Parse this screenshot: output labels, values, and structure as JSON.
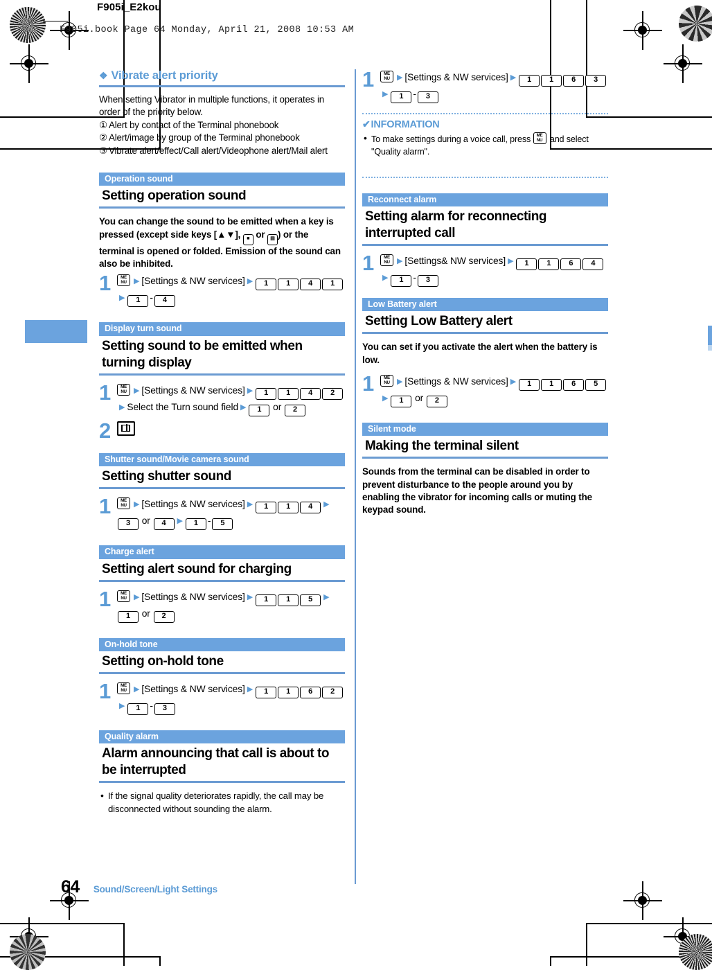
{
  "page": {
    "doc_title": "F905i_E2kou",
    "book_line": "F905i.book  Page 64  Monday, April 21, 2008  10:53 AM",
    "footer_page": "64",
    "footer_chapter": "Sound/Screen/Light Settings",
    "accent_blue": "#6ba3de",
    "heading_blue": "#5b9bd5"
  },
  "left_column": {
    "vibrate": {
      "diamond": "❖",
      "heading": "Vibrate alert priority",
      "intro": "When setting Vibrator in multiple functions, it operates in order of the priority below.",
      "items": [
        {
          "num": "①",
          "text": "Alert by contact of the Terminal phonebook"
        },
        {
          "num": "②",
          "text": "Alert/image by group of the Terminal phonebook"
        },
        {
          "num": "③",
          "text": "Vibrate alert/effect/Call alert/Videophone alert/Mail alert"
        }
      ]
    },
    "operation_sound": {
      "tag": "Operation sound",
      "title": "Setting operation sound",
      "body": "You can change the sound to be emitted when a key is pressed (except side keys [▲▼], ",
      "body_mid": " or ",
      "body_end": ") or the terminal is opened or folded. Emission of the sound can also be inhibited.",
      "step1_num": "1",
      "step1_menu": "MENU",
      "step1_label": "[Settings & NW services]",
      "step1_keys": [
        "1",
        "1",
        "4",
        "1"
      ],
      "step1_range_from": "1",
      "step1_range_to": "4"
    },
    "display_turn_sound": {
      "tag": "Display turn sound",
      "title": "Setting sound to be emitted when turning display",
      "step1_num": "1",
      "step1_label": "[Settings & NW services]",
      "step1_keys": [
        "1",
        "1",
        "4",
        "2"
      ],
      "step1_select": "Select the Turn sound field",
      "step1_opt_a": "1",
      "step1_or": "or",
      "step1_opt_b": "2",
      "step2_num": "2"
    },
    "shutter_sound": {
      "tag": "Shutter sound/Movie camera sound",
      "title": "Setting shutter sound",
      "step1_num": "1",
      "step1_label": "[Settings & NW services]",
      "step1_keys": [
        "1",
        "1",
        "4"
      ],
      "step1_opt_a": "3",
      "step1_or": "or",
      "step1_opt_b": "4",
      "step1_range_from": "1",
      "step1_range_to": "5"
    },
    "charge_alert": {
      "tag": "Charge alert",
      "title": "Setting alert sound for charging",
      "step1_num": "1",
      "step1_label": "[Settings & NW services]",
      "step1_keys": [
        "1",
        "1",
        "5"
      ],
      "step1_opt_a": "1",
      "step1_or": "or",
      "step1_opt_b": "2"
    },
    "on_hold_tone": {
      "tag": "On-hold tone",
      "title": "Setting on-hold tone",
      "step1_num": "1",
      "step1_label": "[Settings & NW services]",
      "step1_keys": [
        "1",
        "1",
        "6",
        "2"
      ],
      "step1_range_from": "1",
      "step1_range_to": "3"
    },
    "quality_alarm": {
      "tag": "Quality alarm",
      "title": "Alarm announcing that call is about to be interrupted",
      "bullet": "If the signal quality deteriorates rapidly, the call may be disconnected without sounding the alarm."
    }
  },
  "right_column": {
    "quality_alarm_step": {
      "step1_num": "1",
      "step1_label": "[Settings & NW services]",
      "step1_keys": [
        "1",
        "1",
        "6",
        "3"
      ],
      "step1_range_from": "1",
      "step1_range_to": "3"
    },
    "information": {
      "check": "✔",
      "heading": "INFORMATION",
      "bullet_pre": "To make settings during a voice call, press ",
      "bullet_post": " and select \"Quality alarm\"."
    },
    "reconnect_alarm": {
      "tag": "Reconnect alarm",
      "title": "Setting alarm for reconnecting interrupted call",
      "step1_num": "1",
      "step1_label": "[Settings& NW services]",
      "step1_keys": [
        "1",
        "1",
        "6",
        "4"
      ],
      "step1_range_from": "1",
      "step1_range_to": "3"
    },
    "low_battery_alert": {
      "tag": "Low Battery alert",
      "title": "Setting Low Battery alert",
      "body": "You can set if you activate the alert when the battery is low.",
      "step1_num": "1",
      "step1_label": "[Settings & NW services]",
      "step1_keys": [
        "1",
        "1",
        "6",
        "5"
      ],
      "step1_opt_a": "1",
      "step1_or": "or",
      "step1_opt_b": "2"
    },
    "silent_mode": {
      "tag": "Silent mode",
      "title": "Making the terminal silent",
      "body": "Sounds from the terminal can be disabled in order to prevent disturbance to the people around you by enabling the vibrator for incoming calls or muting the keypad sound."
    }
  }
}
